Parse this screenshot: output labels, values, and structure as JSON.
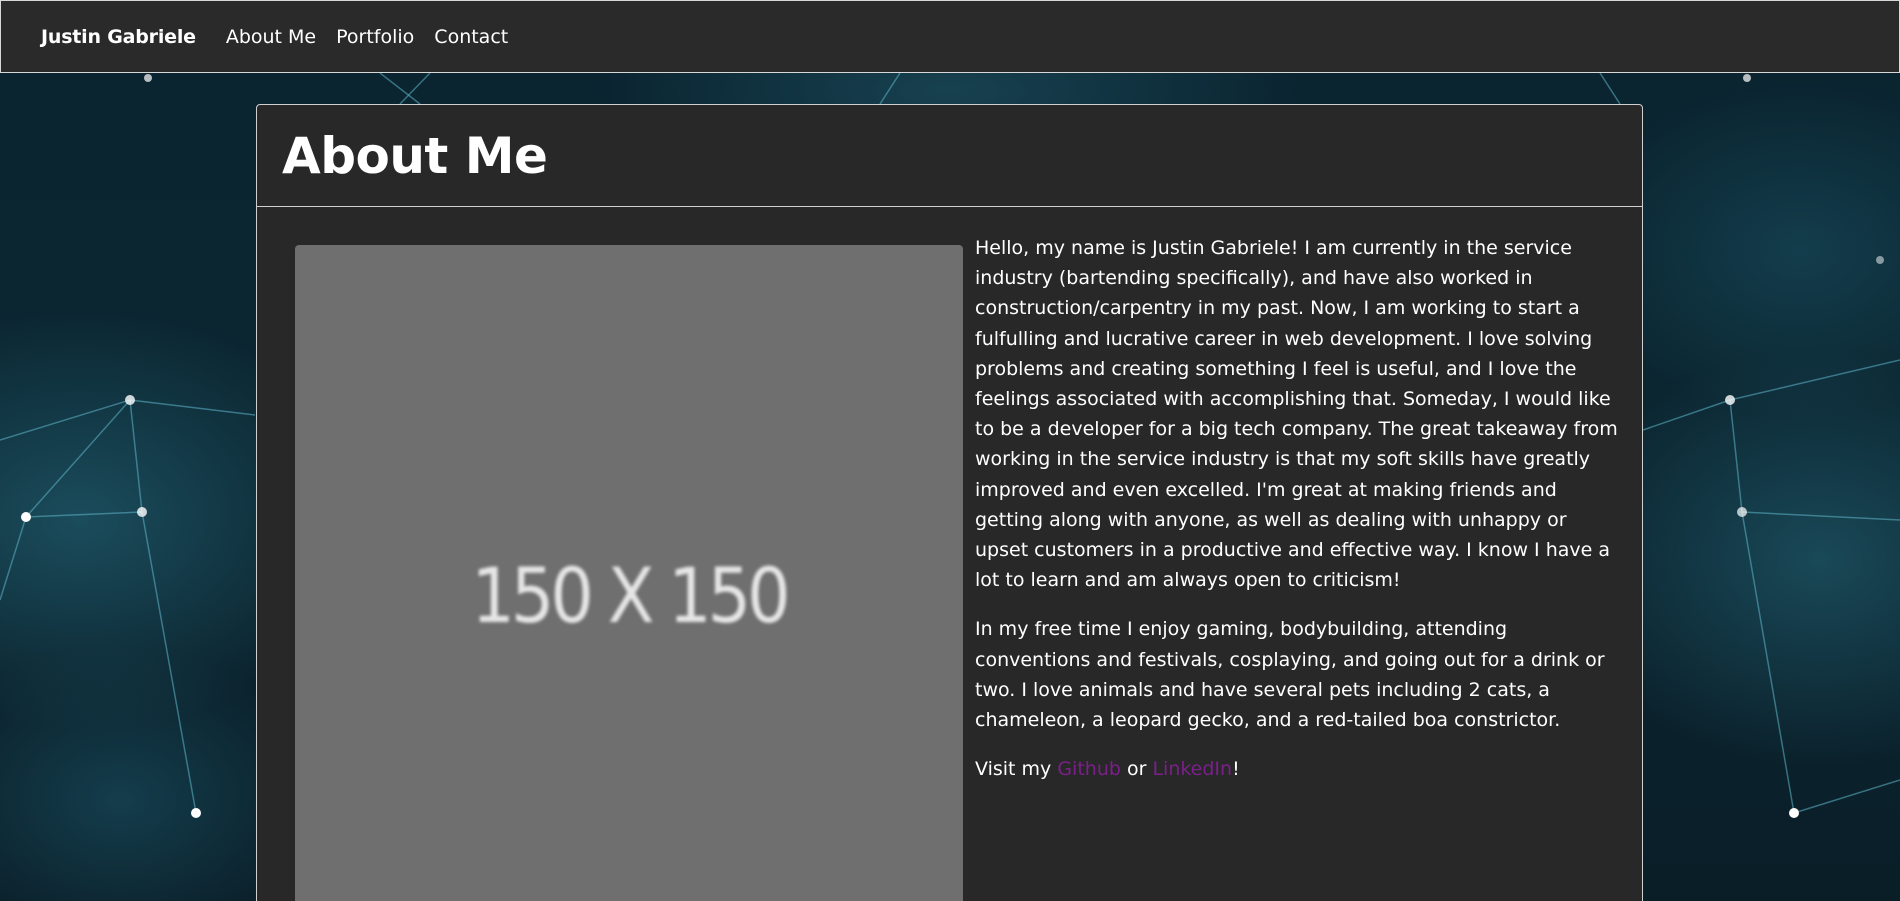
{
  "navbar": {
    "brand": "Justin Gabriele",
    "links": [
      "About Me",
      "Portfolio",
      "Contact"
    ]
  },
  "main": {
    "title": "About Me",
    "image_placeholder": "150 X 150",
    "paragraph_1": "Hello, my name is Justin Gabriele! I am currently in the service industry (bartending specifically), and have also worked in construction/carpentry in my past. Now, I am working to start a fulfulling and lucrative career in web development. I love solving problems and creating something I feel is useful, and I love the feelings associated with accomplishing that. Someday, I would like to be a developer for a big tech company. The great takeaway from working in the service industry is that my soft skills have greatly improved and even excelled. I'm great at making friends and getting along with anyone, as well as dealing with unhappy or upset customers in a productive and effective way. I know I have a lot to learn and am always open to criticism!",
    "paragraph_2": "In my free time I enjoy gaming, bodybuilding, attending conventions and festivals, cosplaying, and going out for a drink or two. I love animals and have several pets including 2 cats, a chameleon, a leopard gecko, and a red-tailed boa constrictor.",
    "visit": {
      "prefix": "Visit my ",
      "github_label": "Github",
      "middle": " or ",
      "linkedin_label": "LinkedIn",
      "suffix": "!"
    }
  },
  "colors": {
    "navbar_bg": "#2a2a2a",
    "card_bg": "#282828",
    "link": "#7b1f8a",
    "placeholder_bg": "#6f6f6f"
  }
}
